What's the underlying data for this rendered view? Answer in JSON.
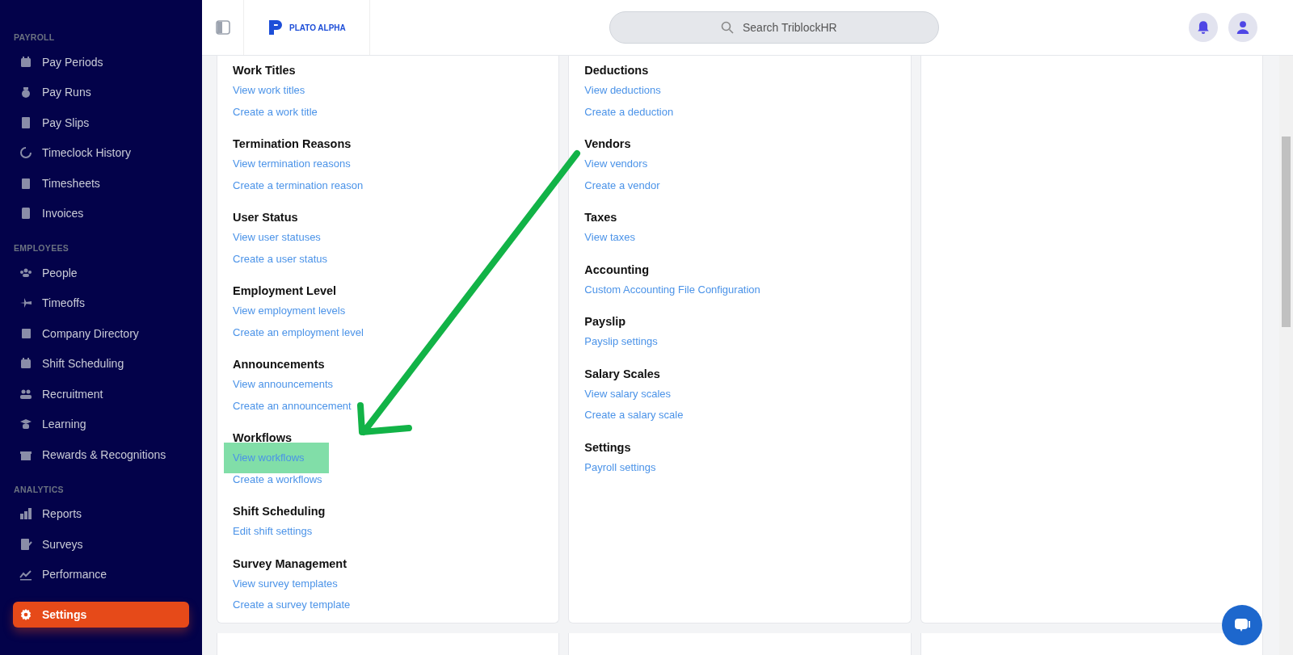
{
  "sidebar": {
    "sections": [
      {
        "title": "PAYROLL",
        "items": [
          {
            "label": "Pay Periods",
            "selected": false
          },
          {
            "label": "Pay Runs",
            "selected": false
          },
          {
            "label": "Pay Slips",
            "selected": false
          },
          {
            "label": "Timeclock History",
            "selected": false
          },
          {
            "label": "Timesheets",
            "selected": false
          },
          {
            "label": "Invoices",
            "selected": false
          }
        ]
      },
      {
        "title": "EMPLOYEES",
        "items": [
          {
            "label": "People",
            "selected": false
          },
          {
            "label": "Timeoffs",
            "selected": false
          },
          {
            "label": "Company Directory",
            "selected": false
          },
          {
            "label": "Shift Scheduling",
            "selected": false
          },
          {
            "label": "Recruitment",
            "selected": false
          },
          {
            "label": "Learning",
            "selected": false
          },
          {
            "label": "Rewards & Recognitions",
            "selected": false
          }
        ]
      },
      {
        "title": "ANALYTICS",
        "items": [
          {
            "label": "Reports",
            "selected": false
          },
          {
            "label": "Surveys",
            "selected": false
          },
          {
            "label": "Performance",
            "selected": false
          }
        ]
      }
    ],
    "bottom_item": {
      "label": "Settings",
      "selected": true
    }
  },
  "header": {
    "logo": "PLATO ALPHA",
    "search": {
      "placeholder": "Search TriblockHR"
    }
  },
  "cards": [
    {
      "groups": [
        {
          "title": "Work Titles",
          "links": [
            {
              "label": "View work titles",
              "highlighted": false
            },
            {
              "label": "Create a work title",
              "highlighted": false
            }
          ]
        },
        {
          "title": "Termination Reasons",
          "links": [
            {
              "label": "View termination reasons",
              "highlighted": false
            },
            {
              "label": "Create a termination reason",
              "highlighted": false
            }
          ]
        },
        {
          "title": "User Status",
          "links": [
            {
              "label": "View user statuses",
              "highlighted": false
            },
            {
              "label": "Create a user status",
              "highlighted": false
            }
          ]
        },
        {
          "title": "Employment Level",
          "links": [
            {
              "label": "View employment levels",
              "highlighted": false
            },
            {
              "label": "Create an employment level",
              "highlighted": false
            }
          ]
        },
        {
          "title": "Announcements",
          "links": [
            {
              "label": "View announcements",
              "highlighted": false
            },
            {
              "label": "Create an announcement",
              "highlighted": false
            }
          ]
        },
        {
          "title": "Workflows",
          "links": [
            {
              "label": "View workflows",
              "highlighted": true
            },
            {
              "label": "Create a workflows",
              "highlighted": false
            }
          ]
        },
        {
          "title": "Shift Scheduling",
          "links": [
            {
              "label": "Edit shift settings",
              "highlighted": false
            }
          ]
        },
        {
          "title": "Survey Management",
          "links": [
            {
              "label": "View survey templates",
              "highlighted": false
            },
            {
              "label": "Create a survey template",
              "highlighted": false
            }
          ]
        }
      ]
    },
    {
      "groups": [
        {
          "title": "Deductions",
          "links": [
            {
              "label": "View deductions",
              "highlighted": false
            },
            {
              "label": "Create a deduction",
              "highlighted": false
            }
          ]
        },
        {
          "title": "Vendors",
          "links": [
            {
              "label": "View vendors",
              "highlighted": false
            },
            {
              "label": "Create a vendor",
              "highlighted": false
            }
          ]
        },
        {
          "title": "Taxes",
          "links": [
            {
              "label": "View taxes",
              "highlighted": false
            }
          ]
        },
        {
          "title": "Accounting",
          "links": [
            {
              "label": "Custom Accounting File Configuration",
              "highlighted": false
            }
          ]
        },
        {
          "title": "Payslip",
          "links": [
            {
              "label": "Payslip settings",
              "highlighted": false
            }
          ]
        },
        {
          "title": "Salary Scales",
          "links": [
            {
              "label": "View salary scales",
              "highlighted": false
            },
            {
              "label": "Create a salary scale",
              "highlighted": false
            }
          ]
        },
        {
          "title": "Settings",
          "links": [
            {
              "label": "Payroll settings",
              "highlighted": false
            }
          ]
        }
      ]
    }
  ]
}
